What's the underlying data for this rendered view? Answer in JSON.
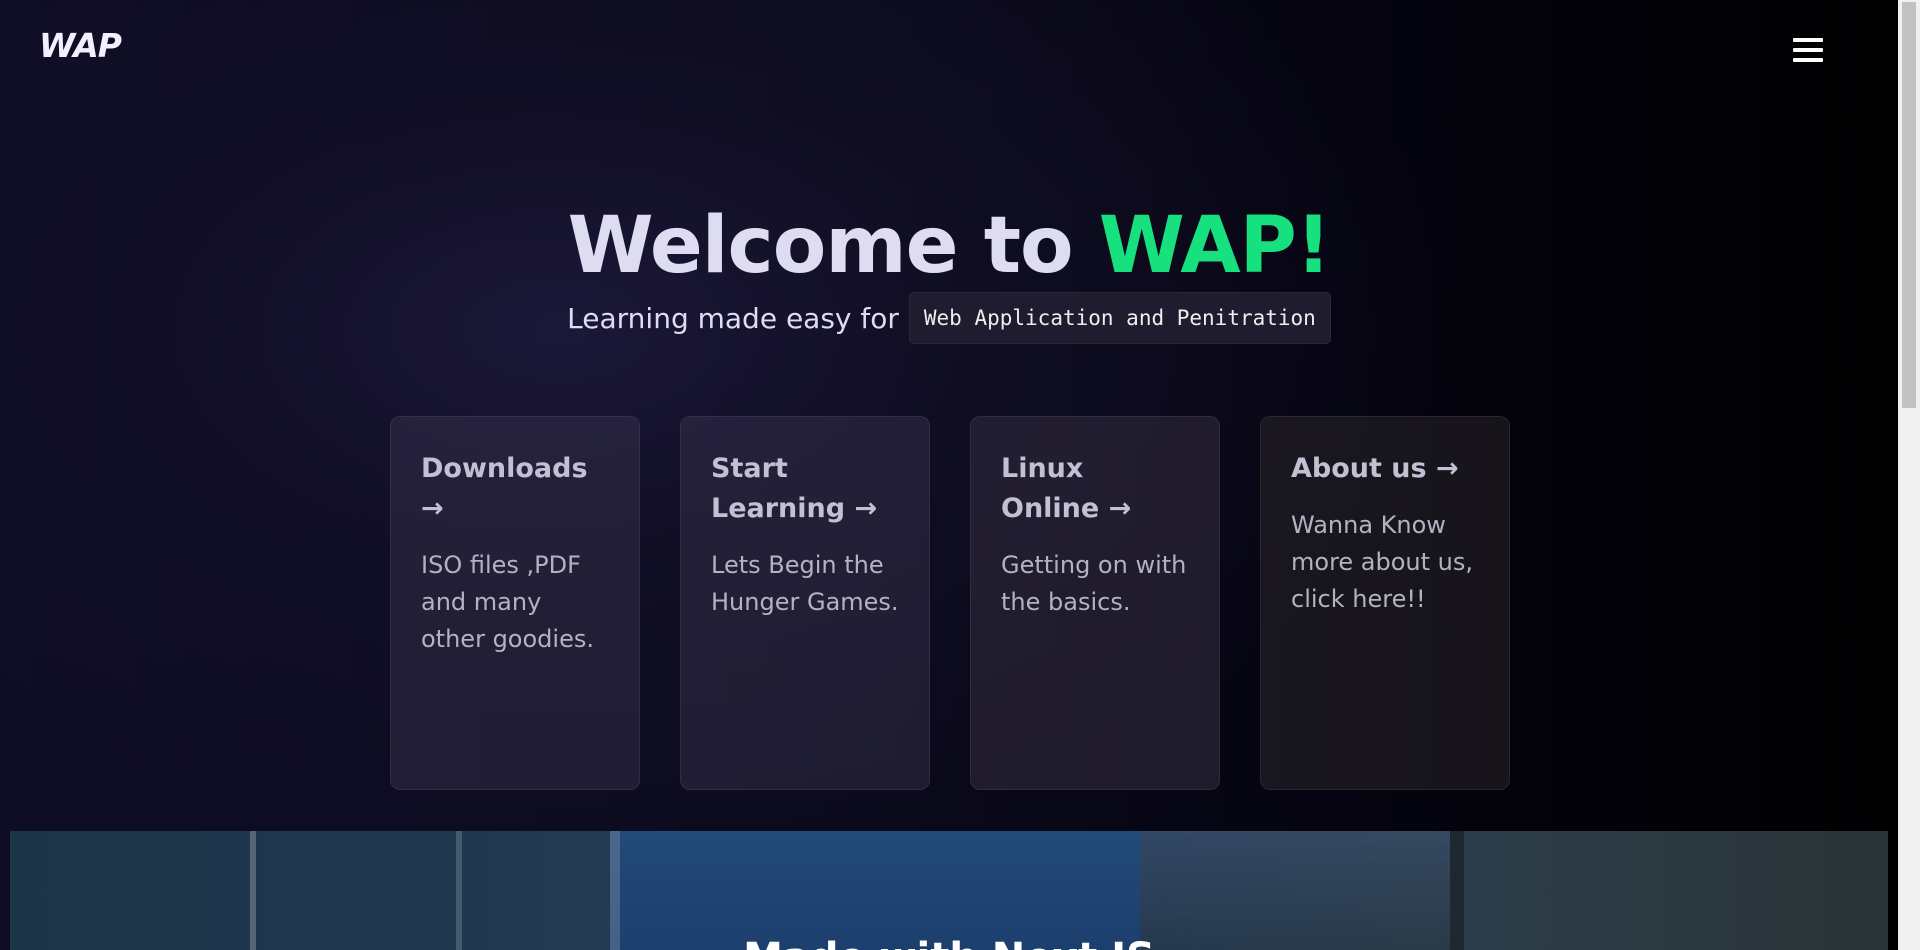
{
  "header": {
    "logo": "WAP",
    "menu_icon": "hamburger-menu-icon"
  },
  "hero": {
    "title_prefix": "Welcome to ",
    "title_accent": "WAP!",
    "subtitle": "Learning made easy for",
    "code_tag": "Web Application and Penitration"
  },
  "cards": [
    {
      "title": "Downloads →",
      "description": "ISO files ,PDF and many other goodies."
    },
    {
      "title": "Start Learning →",
      "description": "Lets Begin the Hunger Games."
    },
    {
      "title": "Linux Online →",
      "description": "Getting on with the basics."
    },
    {
      "title": "About us →",
      "description": "Wanna Know more about us, click here!!"
    }
  ],
  "banner": {
    "title": "Made with Next JS"
  },
  "colors": {
    "accent": "#17e07f",
    "background": "#0f0d26",
    "text": "#dedcf0"
  }
}
